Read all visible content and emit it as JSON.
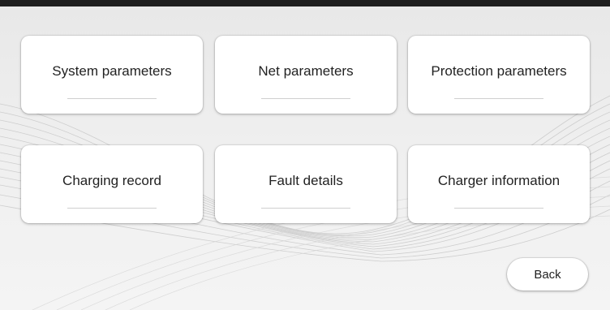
{
  "menu": {
    "items": [
      {
        "label": "System parameters"
      },
      {
        "label": "Net parameters"
      },
      {
        "label": "Protection parameters"
      },
      {
        "label": "Charging record"
      },
      {
        "label": "Fault details"
      },
      {
        "label": "Charger information"
      }
    ]
  },
  "navigation": {
    "back_label": "Back"
  }
}
